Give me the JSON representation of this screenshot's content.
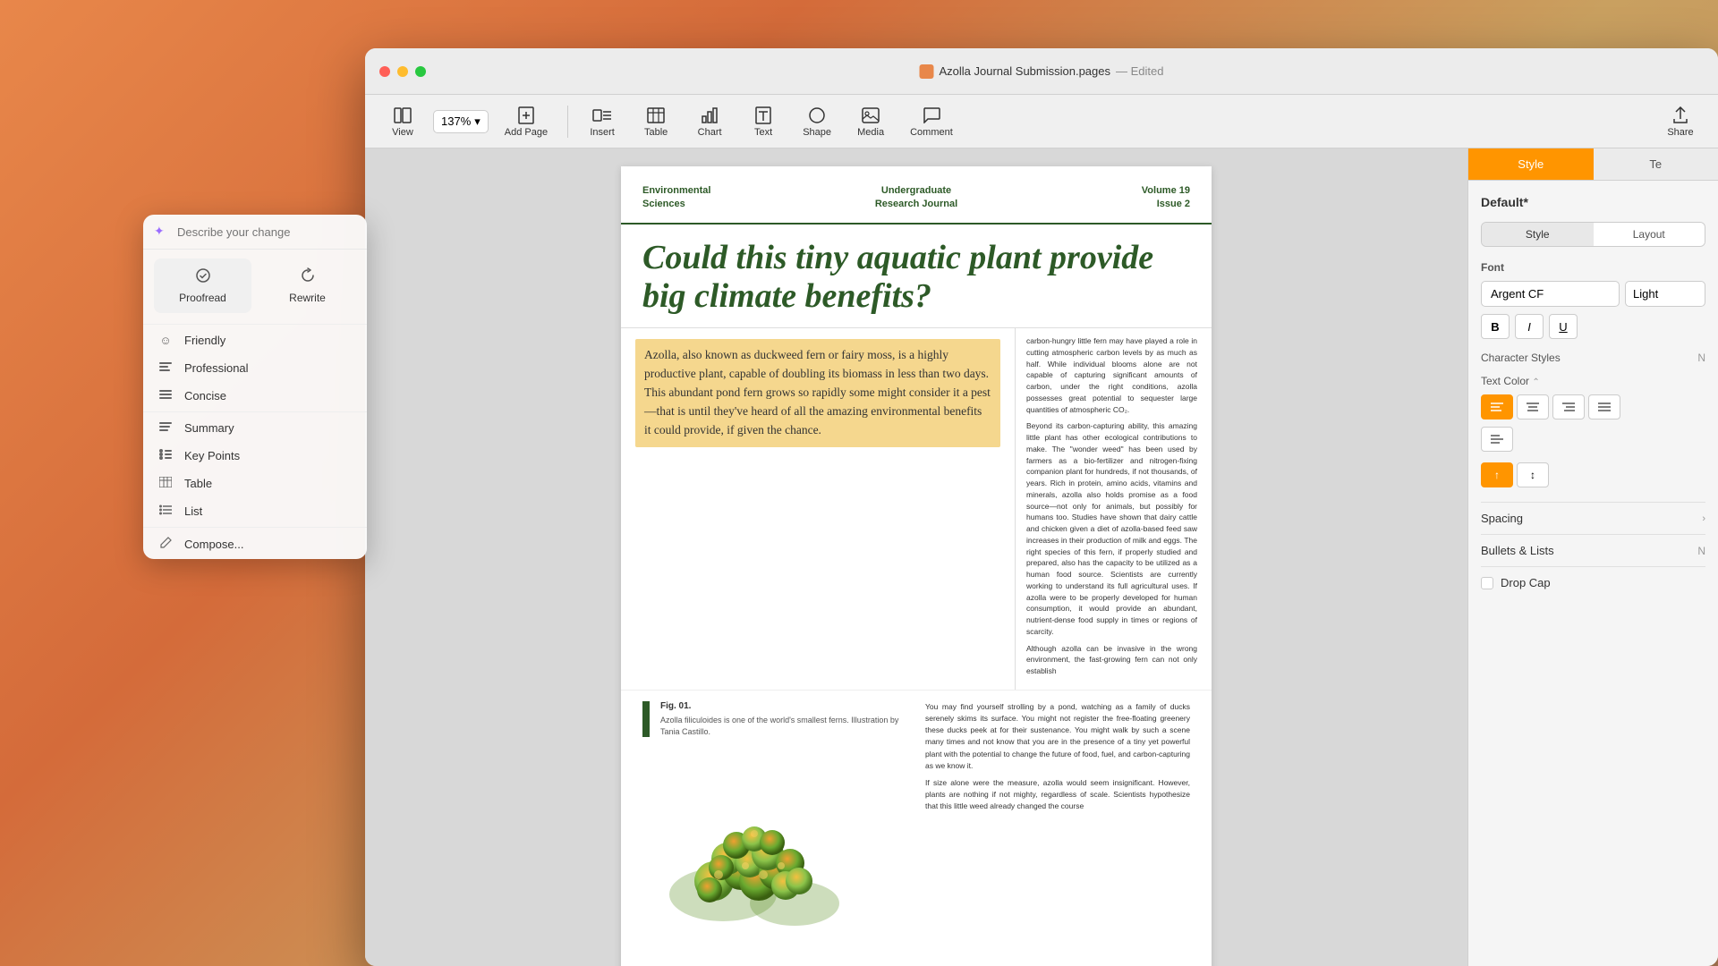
{
  "window": {
    "title": "Azolla Journal Submission.pages",
    "subtitle": "Edited"
  },
  "titlebar": {
    "traffic_lights": [
      "red",
      "yellow",
      "green"
    ]
  },
  "toolbar": {
    "view_label": "View",
    "zoom_value": "137%",
    "add_page_label": "Add Page",
    "insert_label": "Insert",
    "table_label": "Table",
    "chart_label": "Chart",
    "text_label": "Text",
    "shape_label": "Shape",
    "media_label": "Media",
    "comment_label": "Comment",
    "share_label": "Share"
  },
  "journal": {
    "header_left_line1": "Environmental",
    "header_left_line2": "Sciences",
    "header_center_line1": "Undergraduate",
    "header_center_line2": "Research Journal",
    "header_right_line1": "Volume 19",
    "header_right_line2": "Issue 2"
  },
  "article": {
    "title": "Could this tiny aquatic plant provide big climate benefits?",
    "highlighted_paragraph": "Azolla, also known as duckweed fern or fairy moss, is a highly productive plant, capable of doubling its biomass in less than two days. This abundant pond fern grows so rapidly some might consider it a pest—that is until they've heard of all the amazing environmental benefits it could provide, if given the chance.",
    "sidebar_text_1": "carbon-hungry little fern may have played a role in cutting atmospheric carbon levels by as much as half. While individual blooms alone are not capable of capturing significant amounts of carbon, under the right conditions, azolla possesses great potential to sequester large quantities of atmospheric CO₂.",
    "sidebar_text_2": "Beyond its carbon-capturing ability, this amazing little plant has other ecological contributions to make. The \"wonder weed\" has been used by farmers as a bio-fertilizer and nitrogen-fixing companion plant for hundreds, if not thousands, of years. Rich in protein, amino acids, vitamins and minerals, azolla also holds promise as a food source—not only for animals, but possibly for humans too. Studies have shown that dairy cattle and chicken given a diet of azolla-based feed saw increases in their production of milk and eggs. The right species of this fern, if properly studied and prepared, also has the capacity to be utilized as a human food source. Scientists are currently working to understand its full agricultural uses. If azolla were to be properly developed for human consumption, it would provide an abundant, nutrient-dense food supply in times or regions of scarcity.",
    "sidebar_text_3": "Although azolla can be invasive in the wrong environment, the fast-growing fern can not only establish",
    "figure_label": "Fig. 01.",
    "figure_caption": "Azolla filiculoides is one of the world's smallest ferns. Illustration by Tania Castillo.",
    "body_text_1": "You may find yourself strolling by a pond, watching as a family of ducks serenely skims its surface. You might not register the free-floating greenery these ducks peek at for their sustenance. You might walk by such a scene many times and not know that you are in the presence of a tiny yet powerful plant with the potential to change the future of food, fuel, and carbon-capturing as we know it.",
    "body_text_2": "If size alone were the measure, azolla would seem insignificant. However, plants are nothing if not mighty, regardless of scale. Scientists hypothesize that this little weed already changed the course"
  },
  "ai_panel": {
    "input_placeholder": "Describe your change",
    "proofread_label": "Proofread",
    "rewrite_label": "Rewrite",
    "menu_items": [
      {
        "icon": "☺",
        "label": "Friendly"
      },
      {
        "icon": "⊟",
        "label": "Professional"
      },
      {
        "icon": "≡",
        "label": "Concise"
      },
      {
        "icon": "≡",
        "label": "Summary"
      },
      {
        "icon": "•",
        "label": "Key Points"
      },
      {
        "icon": "⊞",
        "label": "Table"
      },
      {
        "icon": "≡",
        "label": "List"
      },
      {
        "icon": "/",
        "label": "Compose..."
      }
    ]
  },
  "right_panel": {
    "tab_style": "Style",
    "tab_text": "Te",
    "default_label": "Default*",
    "style_tab": "Style",
    "layout_tab": "Layout",
    "font_section": "Font",
    "font_name": "Argent CF",
    "font_style": "Light",
    "bold_label": "B",
    "italic_label": "I",
    "underline_label": "U",
    "char_styles_label": "Character Styles",
    "text_color_label": "Text Color",
    "spacing_label": "Spacing",
    "bullets_lists_label": "Bullets & Lists",
    "dropcap_label": "Drop Cap"
  }
}
